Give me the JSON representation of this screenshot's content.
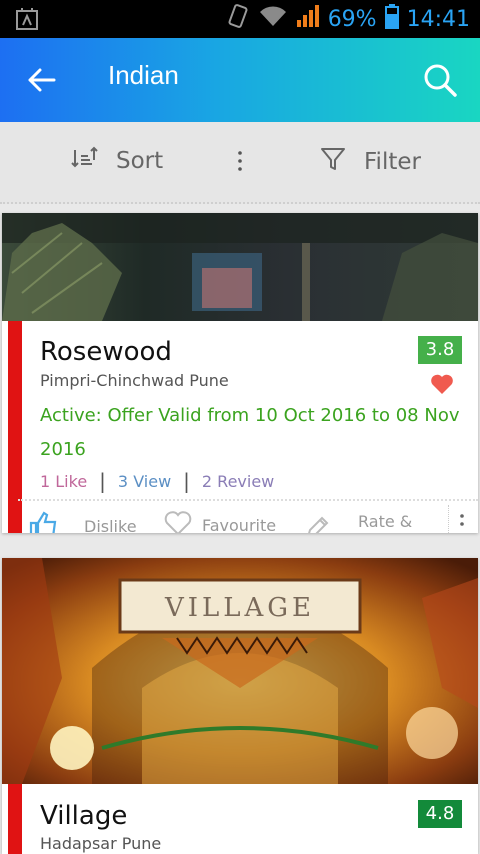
{
  "status_bar": {
    "battery_percent": "69%",
    "time": "14:41",
    "icons": [
      "notification-icon",
      "vibrate-icon",
      "wifi-icon",
      "signal-icon",
      "battery-icon"
    ]
  },
  "app_bar": {
    "title": "Indian",
    "icons": [
      "back-arrow-icon",
      "search-icon"
    ]
  },
  "toolbar": {
    "sort_label": "Sort",
    "filter_label": "Filter"
  },
  "restaurants": [
    {
      "name": "Rosewood",
      "location": "Pimpri-Chinchwad Pune",
      "rating": "3.8",
      "offer": "Active: Offer Valid from 10 Oct 2016 to 08 Nov 2016",
      "likes": "1 Like",
      "views": "3 View",
      "reviews": "2 Review",
      "actions": {
        "dislike": "Dislike",
        "favourite": "Favourite",
        "rate": "Rate &"
      }
    },
    {
      "name": "Village",
      "location": "Hadapsar Pune",
      "rating": "4.8",
      "sign_text": "VILLAGE"
    }
  ],
  "colors": {
    "accent_red": "#e01313",
    "rating_green": "#45b04a",
    "rating_dark_green": "#138a3a",
    "offer_green": "#3ba31f",
    "status_blue": "#2aa4f4"
  }
}
